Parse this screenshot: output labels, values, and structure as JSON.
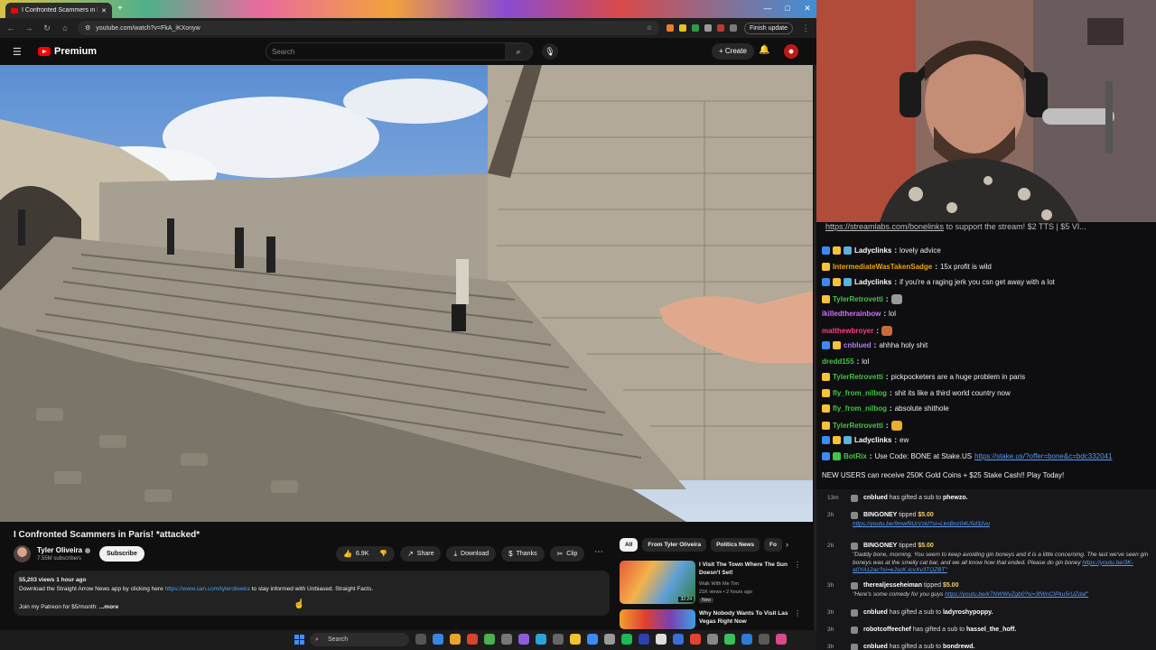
{
  "browser": {
    "tab_title": "I Confronted Scammers in Paris!",
    "url": "youtube.com/watch?v=FkA_iKXonyw",
    "finish_update": "Finish update",
    "window_controls": [
      "—",
      "□",
      "✕"
    ]
  },
  "youtube": {
    "brand": "Premium",
    "search_placeholder": "Search",
    "create_label": "Create"
  },
  "video": {
    "title": "I Confronted Scammers in Paris! *attacked*",
    "channel": "Tyler Oliveira",
    "subscribers": "7.55M subscribers",
    "subscribe_label": "Subscribe",
    "likes": "6.9K",
    "share": "Share",
    "download": "Download",
    "thanks": "Thanks",
    "clip": "Clip",
    "stats": "55,203 views  1 hour ago",
    "desc_line1_pre": "Download the Straight Arrow News app by clicking here ",
    "desc_link": "https://www.san.com/tyleroliveira",
    "desc_line1_post": " to stay informed with Unbiased. Straight Facts.",
    "desc_line2": "Join my Patreon for $5/month:",
    "more": "...more"
  },
  "recommendations": {
    "chips": [
      "All",
      "From Tyler Oliveira",
      "Politics News",
      "Fo"
    ],
    "items": [
      {
        "title": "I Visit The Town Where The Sun Doesn't Set!",
        "channel": "Walk With Me Tim",
        "meta": "21K views • 2 hours ago",
        "badge": "New",
        "duration": "32:24"
      },
      {
        "title": "Why Nobody Wants To Visit Las Vegas Right Now",
        "channel": "",
        "meta": "",
        "badge": "",
        "duration": ""
      }
    ]
  },
  "taskbar": {
    "search_label": "Search"
  },
  "chat": {
    "top_link": "https://streamlabs.com/bonelinks",
    "top_text": " to support the stream! $2 TTS | $5 VI...",
    "messages": [
      {
        "user": "Ladyclinks",
        "color": "#ffffff",
        "text": "lovely advice",
        "badges": [
          "#3a8bf7",
          "#f7c23a",
          "#5ab1d9"
        ]
      },
      {
        "user": "IntermediateWasTakenSadge",
        "color": "#f0a500",
        "text": "15x profit is wild",
        "badges": [
          "#f7c23a"
        ]
      },
      {
        "user": "Ladyclinks",
        "color": "#ffffff",
        "text": "if you're a raging jerk you csn get away with a lot",
        "badges": [
          "#3a8bf7",
          "#f7c23a",
          "#5ab1d9"
        ]
      },
      {
        "user": "TylerRetrovetti",
        "color": "#43c443",
        "text": "",
        "badges": [
          "#f7c23a"
        ],
        "emote": "#9a9a9a"
      },
      {
        "user": "ikilledtherainbow",
        "color": "#d66cff",
        "text": "lol",
        "badges": []
      },
      {
        "user": "matthewbroyer",
        "color": "#ff3d7f",
        "text": "",
        "badges": [],
        "emote": "#c86b3c"
      },
      {
        "user": "cnblued",
        "color": "#b47cf2",
        "text": "ahhha holy shit",
        "badges": [
          "#3a8bf7",
          "#f7c23a"
        ]
      },
      {
        "user": "dredd155",
        "color": "#43c443",
        "text": "lol",
        "badges": []
      },
      {
        "user": "TylerRetrovetti",
        "color": "#43c443",
        "text": "pickpocketers are a huge problem in paris",
        "badges": [
          "#f7c23a"
        ]
      },
      {
        "user": "fly_from_nilbog",
        "color": "#43c443",
        "text": "shit its like a third world country now",
        "badges": [
          "#f7c23a"
        ]
      },
      {
        "user": "fly_from_nilbog",
        "color": "#43c443",
        "text": "absolute shithole",
        "badges": [
          "#f7c23a"
        ]
      },
      {
        "user": "TylerRetrovetti",
        "color": "#43c443",
        "text": "",
        "badges": [
          "#f7c23a"
        ],
        "emote": "#e6b128"
      },
      {
        "user": "Ladyclinks",
        "color": "#ffffff",
        "text": "ew",
        "badges": [
          "#3a8bf7",
          "#f7c23a",
          "#5ab1d9"
        ]
      },
      {
        "user": "BotRix",
        "color": "#43c443",
        "text": "Use Code: BONE at Stake.US ",
        "link": "https://stake.us/?offer=bone&c=bdc332041",
        "badges": [
          "#3a8bf7",
          "#43c443"
        ]
      }
    ],
    "botrix_line2": "NEW USERS can receive 250K Gold Coins + $25 Stake Cash!! Play Today!"
  },
  "events": [
    {
      "time": "13m",
      "user": "cnblued",
      "text": " has gifted a sub to ",
      "target": "phewzo.",
      "amount": "",
      "sub": ""
    },
    {
      "time": "2h",
      "user": "BINGONEY",
      "text": " tipped ",
      "target": "",
      "amount": "$5.00",
      "sub": "",
      "sublink": "https://youtu.be/9mwf9UrVzkI?si=LknBnz04U5d32vu"
    },
    {
      "time": "2h",
      "user": "BINGONEY",
      "text": " tipped ",
      "target": "",
      "amount": "$5.00",
      "sub": "\"Daddy bone, morning. You seem to keep avoiding gin boneys and it is a little concerning. The last we've seen gin boneys was at the smelly cat bar, and we all know how that ended. Please do gin boney ",
      "sublink": "https://youtu.be/3K-a0YA12ac?si=eJscK-IcvXv3TQZBT\""
    },
    {
      "time": "3h",
      "user": "therealjesseheiman",
      "text": " tipped ",
      "target": "",
      "amount": "$5.00",
      "sub": "\"Here's some comedy for you guys ",
      "sublink": "https://youtu.be/k7NWWvZgb0?si=3fWnCIPku5rUZdaf\""
    },
    {
      "time": "3h",
      "user": "cnblued",
      "text": " has gifted a sub to ",
      "target": "ladyroshypoppy.",
      "amount": "",
      "sub": ""
    },
    {
      "time": "3h",
      "user": "robotcoffeechef",
      "text": " has gifted a sub to ",
      "target": "hassel_the_hoff.",
      "amount": "",
      "sub": ""
    },
    {
      "time": "3h",
      "user": "cnblued",
      "text": " has gifted a sub to ",
      "target": "bondrewd.",
      "amount": "",
      "sub": ""
    }
  ]
}
